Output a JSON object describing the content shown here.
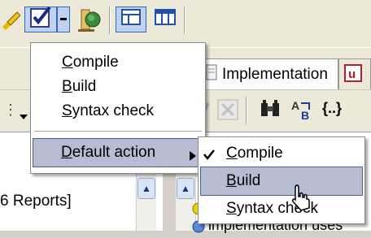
{
  "top_toolbar": {
    "buttons": [
      "compile-check-icon",
      "dropdown-arrow",
      "run-globe-icon",
      "layout-panes-icon",
      "columns-icon"
    ]
  },
  "tabs": {
    "implementation": "Implementation"
  },
  "left_pane": {
    "text": "6 Reports]"
  },
  "right_pane": {
    "item_text": "implementation uses"
  },
  "toolbar2": {
    "glyph_braces": "{..}"
  },
  "main_menu": {
    "items": [
      {
        "label": "Compile",
        "mnemonic": "C"
      },
      {
        "label": "Build",
        "mnemonic": "B"
      },
      {
        "label": "Syntax check",
        "mnemonic": "S"
      },
      {
        "label": "Default action",
        "mnemonic": "D",
        "has_submenu": true
      }
    ]
  },
  "submenu": {
    "items": [
      {
        "label": "Compile",
        "checked": true
      },
      {
        "label": "Build",
        "highlighted": true
      },
      {
        "label": "Syntax check"
      }
    ]
  },
  "colors": {
    "menu_highlight": "#b6bdd2",
    "toolbar_bg": "#ece9d8"
  }
}
